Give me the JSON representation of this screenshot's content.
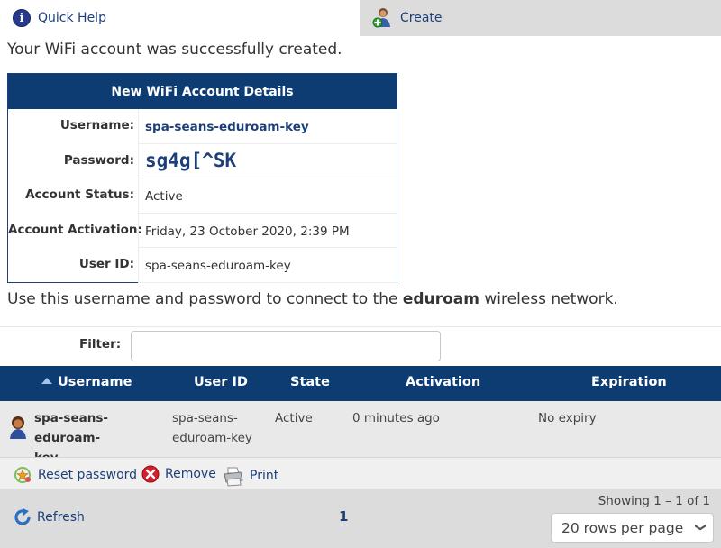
{
  "tabs": [
    {
      "label": "Quick Help",
      "icon": "info-icon"
    },
    {
      "label": "Create",
      "icon": "create-user-icon"
    }
  ],
  "messages": {
    "success": "Your WiFi account was successfully created.",
    "connect_prefix": "Use this username and password to connect to the ",
    "connect_network": "eduroam",
    "connect_suffix": " wireless network."
  },
  "details": {
    "title": "New WiFi Account Details",
    "rows": [
      {
        "label": "Username:",
        "value": "spa-seans-eduroam-key"
      },
      {
        "label": "Password:",
        "value": "sg4g[^SK"
      },
      {
        "label": "Account Status:",
        "value": "Active"
      },
      {
        "label": "Account Activation:",
        "value": "Friday, 23 October 2020, 2:39 PM"
      },
      {
        "label": "User ID:",
        "value": "spa-seans-eduroam-key"
      }
    ]
  },
  "filter": {
    "label": "Filter:",
    "value": "",
    "placeholder": ""
  },
  "grid": {
    "columns": [
      "Username",
      "User ID",
      "State",
      "Activation",
      "Expiration"
    ],
    "sorted_column": "Username",
    "rows": [
      {
        "username_line1": "spa-seans-eduroam-",
        "username_line2": "key",
        "userid_line1": "spa-seans-",
        "userid_line2": "eduroam-key",
        "state": "Active",
        "activation": "0 minutes ago",
        "expiration": "No expiry"
      }
    ],
    "actions": [
      {
        "label": "Reset password",
        "icon": "reset-password-icon"
      },
      {
        "label": "Remove",
        "icon": "remove-icon"
      },
      {
        "label": "Print",
        "icon": "printer-icon"
      }
    ]
  },
  "footer": {
    "refresh": "Refresh",
    "page": "1",
    "showing": "Showing 1 – 1 of 1",
    "rows_per_page": "20 rows per page"
  },
  "colors": {
    "header_navy": "#0d3c73",
    "link_blue": "#1c3f7a",
    "row_gray": "#e9e9e9",
    "bar_gray": "#dcdcdc"
  }
}
